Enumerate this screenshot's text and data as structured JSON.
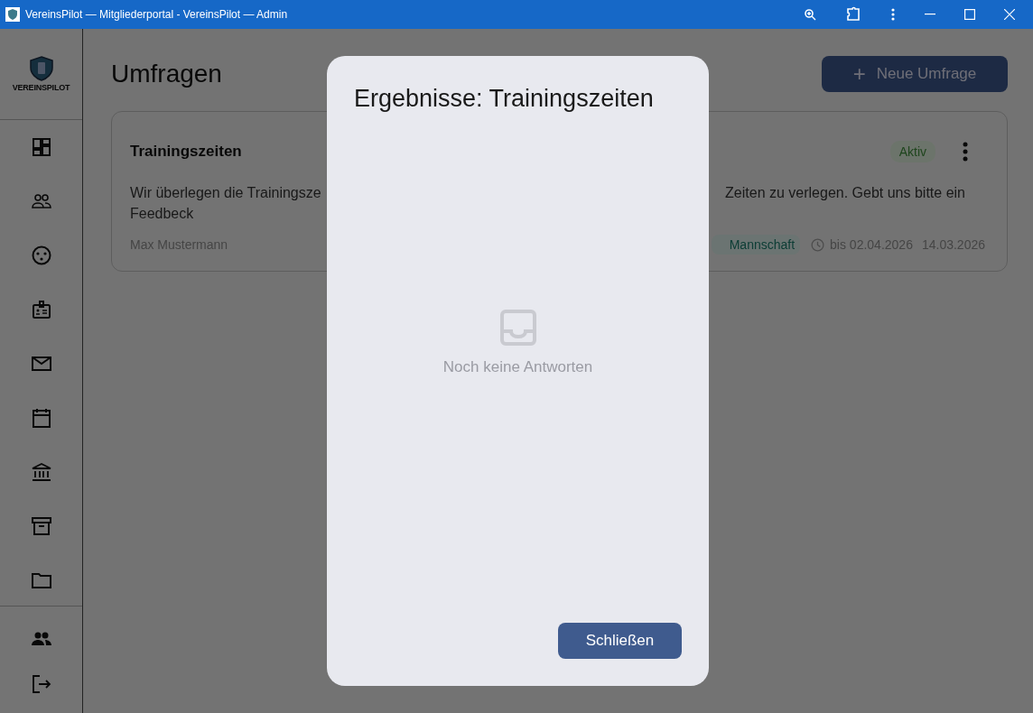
{
  "window": {
    "title": "VereinsPilot — Mitgliederportal - VereinsPilot — Admin"
  },
  "logo": {
    "text": "VEREINSPILOT"
  },
  "page": {
    "title": "Umfragen",
    "new_button": {
      "icon": "+",
      "label": "Neue Umfrage"
    }
  },
  "poll": {
    "title": "Trainingszeiten",
    "status": "Aktiv",
    "description_left": "Wir überlegen die Trainingsze",
    "description_right": "Zeiten zu verlegen. Gebt uns bitte ein",
    "description_end": "Feedbeck",
    "author": "Max Mustermann",
    "tag": "Mannschaft",
    "deadline": "bis 02.04.2026",
    "date": "14.03.2026"
  },
  "dialog": {
    "title": "Ergebnisse: Trainingszeiten",
    "empty_text": "Noch keine Antworten",
    "close_button": "Schließen"
  }
}
